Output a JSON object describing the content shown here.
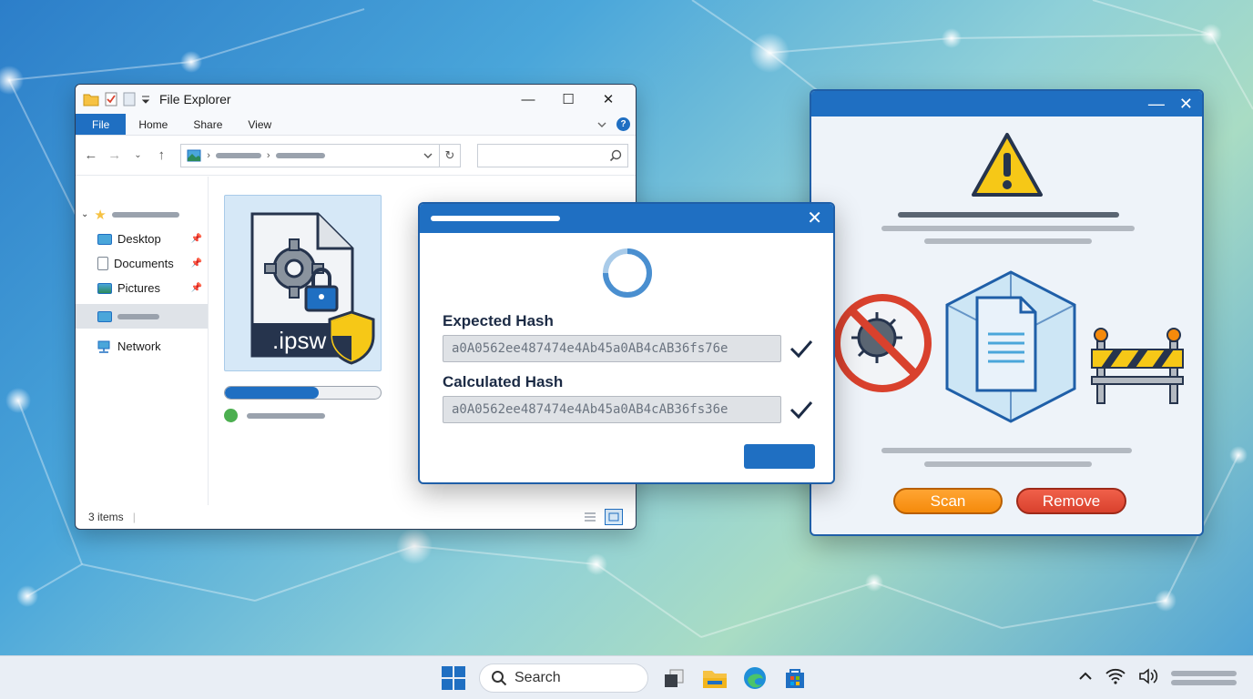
{
  "explorer": {
    "title": "File Explorer",
    "ribbon_tabs": [
      "File",
      "Home",
      "Share",
      "View"
    ],
    "sidebar": [
      {
        "label": "Desktop",
        "icon": "desktop-icon"
      },
      {
        "label": "Documents",
        "icon": "documents-icon"
      },
      {
        "label": "Pictures",
        "icon": "pictures-icon"
      },
      {
        "label": "Network",
        "icon": "network-icon"
      }
    ],
    "file": {
      "extension": ".ipsw",
      "icon": "ipsw-file-icon"
    },
    "copy_progress": 0.6,
    "status_text": "3 items"
  },
  "hash_dialog": {
    "expected_label": "Expected Hash",
    "expected_value": "a0A0562ee487474e4Ab45a0AB4cAB36fs76e",
    "calculated_label": "Calculated Hash",
    "calculated_value": "a0A0562ee487474e4Ab45a0AB4cAB36fs36e"
  },
  "security_window": {
    "scan_label": "Scan",
    "remove_label": "Remove"
  },
  "taskbar": {
    "search_placeholder": "Search"
  },
  "colors": {
    "accent": "#1f6fc2",
    "warning": "#f6c817",
    "scan": "#f58a0b",
    "remove": "#d9412d",
    "success": "#4caf50"
  }
}
